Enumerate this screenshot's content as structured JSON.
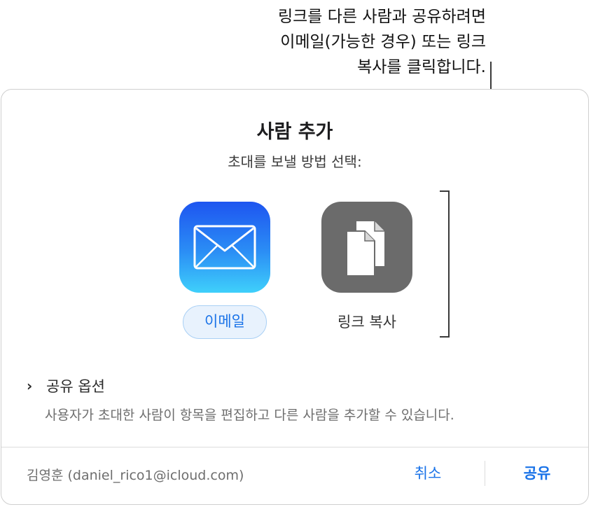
{
  "callout": {
    "lines": [
      "링크를 다른 사람과 공유하려면",
      "이메일(가능한 경우) 또는 링크",
      "복사를 클릭합니다."
    ]
  },
  "dialog": {
    "title": "사람 추가",
    "subtitle": "초대를 보낼 방법 선택:",
    "options": {
      "email": {
        "icon": "mail-envelope-icon",
        "label": "이메일",
        "accent": "#1a73e8"
      },
      "copy_link": {
        "icon": "copy-documents-icon",
        "label": "링크 복사"
      }
    },
    "share_options": {
      "toggle_label": "공유 옵션",
      "description": "사용자가 초대한 사람이 항목을 편집하고 다른 사람을 추가할 수 있습니다."
    },
    "footer": {
      "user": "김영훈 (daniel_rico1@icloud.com)",
      "cancel_label": "취소",
      "share_label": "공유"
    }
  }
}
